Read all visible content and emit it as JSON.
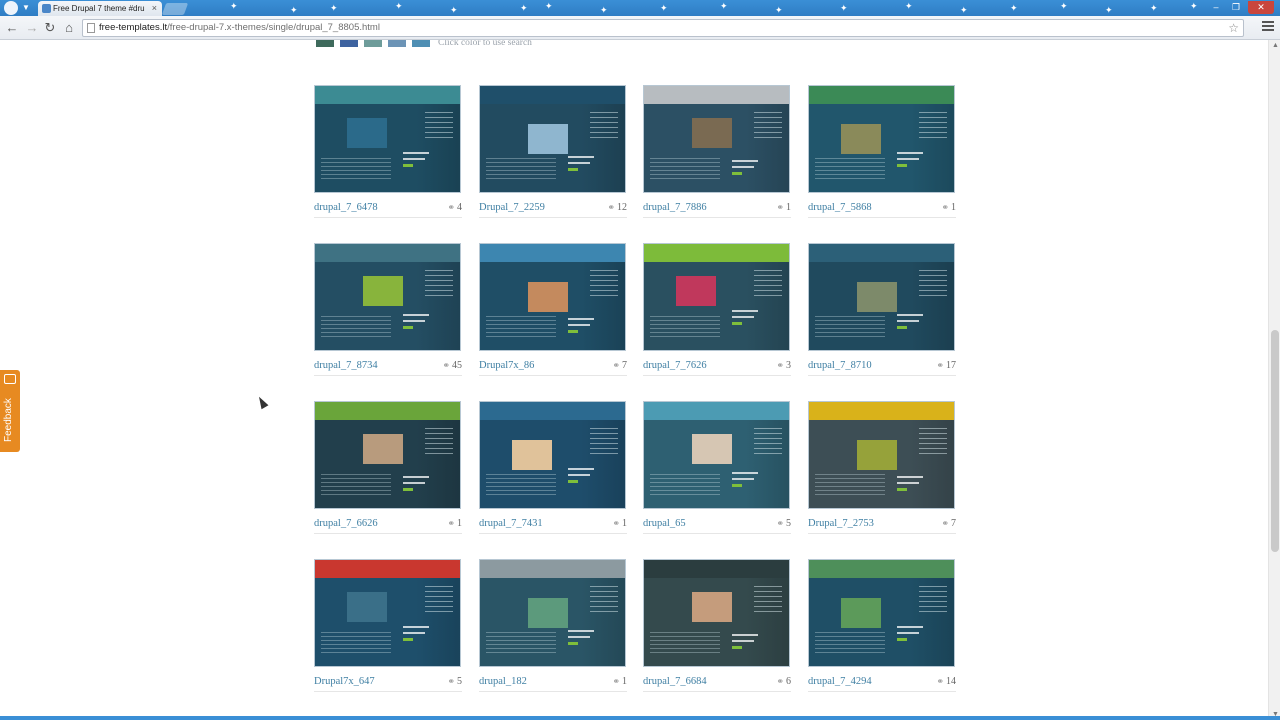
{
  "browser": {
    "tab_title": "Free Drupal 7 theme #dru",
    "url_domain": "free-templates.lt",
    "url_path": "/free-drupal-7.x-themes/single/drupal_7_8805.html",
    "accent": "#3a8fd6"
  },
  "swatches": {
    "colors": [
      "#3e6a5c",
      "#3e63a0",
      "#6e9c9a",
      "#6c94b6",
      "#4f8fb4"
    ],
    "hint": "Click color to use search"
  },
  "feedback": {
    "label": "Feedback",
    "color": "#e78a21"
  },
  "templates": [
    {
      "name": "drupal_7_6478",
      "count": "4"
    },
    {
      "name": "Drupal_7_2259",
      "count": "12"
    },
    {
      "name": "drupal_7_7886",
      "count": "1"
    },
    {
      "name": "drupal_7_5868",
      "count": "1"
    },
    {
      "name": "drupal_7_8734",
      "count": "45"
    },
    {
      "name": "Drupal7x_86",
      "count": "7"
    },
    {
      "name": "drupal_7_7626",
      "count": "3"
    },
    {
      "name": "drupal_7_8710",
      "count": "17"
    },
    {
      "name": "drupal_7_6626",
      "count": "1"
    },
    {
      "name": "drupal_7_7431",
      "count": "1"
    },
    {
      "name": "drupal_65",
      "count": "5"
    },
    {
      "name": "Drupal_7_2753",
      "count": "7"
    },
    {
      "name": "Drupal7x_647",
      "count": "5"
    },
    {
      "name": "drupal_182",
      "count": "1"
    },
    {
      "name": "drupal_7_6684",
      "count": "6"
    },
    {
      "name": "drupal_7_4294",
      "count": "14"
    }
  ]
}
